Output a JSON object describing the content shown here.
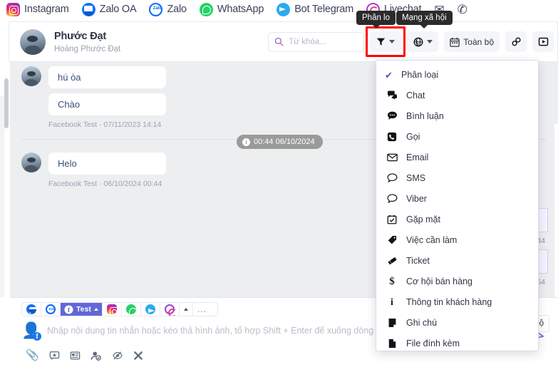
{
  "channel_bar": {
    "items": [
      {
        "label": "Instagram",
        "icon": "instagram-icon"
      },
      {
        "label": "Zalo OA",
        "icon": "zalo-oa-icon"
      },
      {
        "label": "Zalo",
        "icon": "zalo-icon"
      },
      {
        "label": "WhatsApp",
        "icon": "whatsapp-icon"
      },
      {
        "label": "Bot Telegram",
        "icon": "telegram-icon"
      },
      {
        "label": "Livechat",
        "icon": "livechat-icon"
      },
      {
        "label": "",
        "icon": "envelope-icon",
        "glyph": "✉"
      },
      {
        "label": "",
        "icon": "phone-icon",
        "glyph": "✆"
      }
    ]
  },
  "tooltips": {
    "classify": "Phân lo",
    "social": "Mạng xã hội"
  },
  "conversation": {
    "title": "Phước Đạt",
    "subtitle": "Hoàng Phước Đạt",
    "avatar_name": "contact-avatar"
  },
  "header_actions": {
    "search_placeholder": "Từ khóa...",
    "search_icon": "magnifier-icon",
    "filter_icon": "funnel-icon",
    "globe_icon": "globe-icon",
    "calendar_icon": "calendar-icon",
    "date_label": "Toàn bộ",
    "link_icon": "link-icon",
    "video_icon": "video-play-icon",
    "highlight_color": "#ff0000"
  },
  "messages": {
    "date_chip": "00:44 06/10/2024",
    "groups": [
      {
        "bubbles": [
          "hú òa",
          "Chào"
        ],
        "meta": "Facebook Test · 07/11/2023 14:14"
      },
      {
        "bubbles": [
          "Helo"
        ],
        "meta": "Facebook Test · 06/10/2024 00:44"
      }
    ],
    "outgoing_meta": [
      "44",
      "54"
    ]
  },
  "composer": {
    "tabs": [
      {
        "label": "",
        "icon": "zalo-oa-icon",
        "active": false
      },
      {
        "label": "",
        "icon": "zalo-icon",
        "active": false
      },
      {
        "label": "Test",
        "icon": "facebook-icon",
        "active": true
      },
      {
        "label": "",
        "icon": "instagram-icon",
        "active": false
      },
      {
        "label": "",
        "icon": "whatsapp-icon",
        "active": false
      },
      {
        "label": "",
        "icon": "telegram-icon",
        "active": false
      },
      {
        "label": "",
        "icon": "livechat-icon",
        "active": false
      }
    ],
    "more_label": "...",
    "sender_icon": "person-facebook-icon",
    "placeholder": "Nhập nội dung tin nhắn hoặc kéo thả hình ảnh, tổ hợp Shift + Enter để xuống dòng",
    "tools": [
      {
        "name": "attachment-icon",
        "glyph": "📎"
      },
      {
        "name": "quick-reply-icon",
        "glyph": "☆"
      },
      {
        "name": "template-icon",
        "glyph": "▤"
      },
      {
        "name": "assign-user-icon",
        "glyph": "☺"
      },
      {
        "name": "hide-icon",
        "glyph": "◑"
      },
      {
        "name": "close-icon",
        "glyph": "✖"
      }
    ],
    "send_icon": "send-paper-plane-icon",
    "date_ghost_label": "n bộ"
  },
  "dropdown": {
    "header": {
      "label": "Phân loại",
      "checked": true
    },
    "items": [
      {
        "label": "Chat",
        "icon": "chats-icon",
        "glyph": "🗩"
      },
      {
        "label": "Bình luận",
        "icon": "comment-icon",
        "glyph": "💬"
      },
      {
        "label": "Gọi",
        "icon": "call-icon",
        "glyph": "☎"
      },
      {
        "label": "Email",
        "icon": "envelope-icon",
        "glyph": "✉"
      },
      {
        "label": "SMS",
        "icon": "sms-icon",
        "glyph": "💭"
      },
      {
        "label": "Viber",
        "icon": "viber-icon",
        "glyph": "💭"
      },
      {
        "label": "Gặp mặt",
        "icon": "calendar-check-icon",
        "glyph": "🗓"
      },
      {
        "label": "Việc cần làm",
        "icon": "tag-icon",
        "glyph": "🏷"
      },
      {
        "label": "Ticket",
        "icon": "ticket-icon",
        "glyph": "🎫"
      },
      {
        "label": "Cơ hội bán hàng",
        "icon": "dollar-icon",
        "glyph": "$"
      },
      {
        "label": "Thông tin khách hàng",
        "icon": "info-icon",
        "glyph": "i"
      },
      {
        "label": "Ghi chú",
        "icon": "note-icon",
        "glyph": "🗒"
      },
      {
        "label": "File đính kèm",
        "icon": "file-icon",
        "glyph": "🗋"
      }
    ]
  }
}
